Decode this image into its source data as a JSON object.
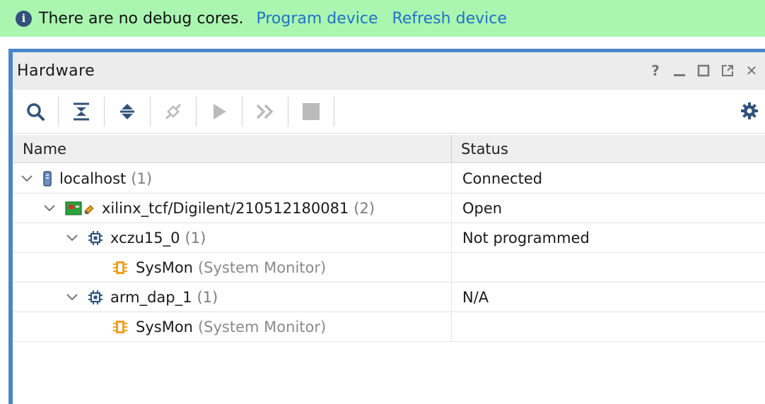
{
  "banner": {
    "message": "There are no debug cores.",
    "program_link": "Program device",
    "refresh_link": "Refresh device"
  },
  "panel": {
    "title": "Hardware",
    "window_buttons": [
      "help",
      "minimize",
      "maximize",
      "float",
      "close"
    ],
    "help_label": "?",
    "close_label": "✕"
  },
  "table": {
    "columns": [
      "Name",
      "Status"
    ],
    "rows": [
      {
        "name": "localhost",
        "count": "(1)",
        "status": "Connected",
        "icon": "server-icon"
      },
      {
        "name": "xilinx_tcf/Digilent/210512180081",
        "count": "(2)",
        "status": "Open",
        "icon": "jtag-board-icon"
      },
      {
        "name": "xczu15_0",
        "count": "(1)",
        "status": "Not programmed",
        "icon": "chip-icon"
      },
      {
        "name": "SysMon",
        "count": "(System Monitor)",
        "status": "",
        "icon": "sysmon-icon"
      },
      {
        "name": "arm_dap_1",
        "count": "(1)",
        "status": "N/A",
        "icon": "chip-icon"
      },
      {
        "name": "SysMon",
        "count": "(System Monitor)",
        "status": "",
        "icon": "sysmon-icon"
      }
    ]
  },
  "colors": {
    "banner_bg": "#aaf6b1",
    "link": "#1e72c8",
    "panel_accent": "#4a86c8",
    "icon_navy": "#31537a",
    "sysmon_orange": "#f0a020"
  }
}
